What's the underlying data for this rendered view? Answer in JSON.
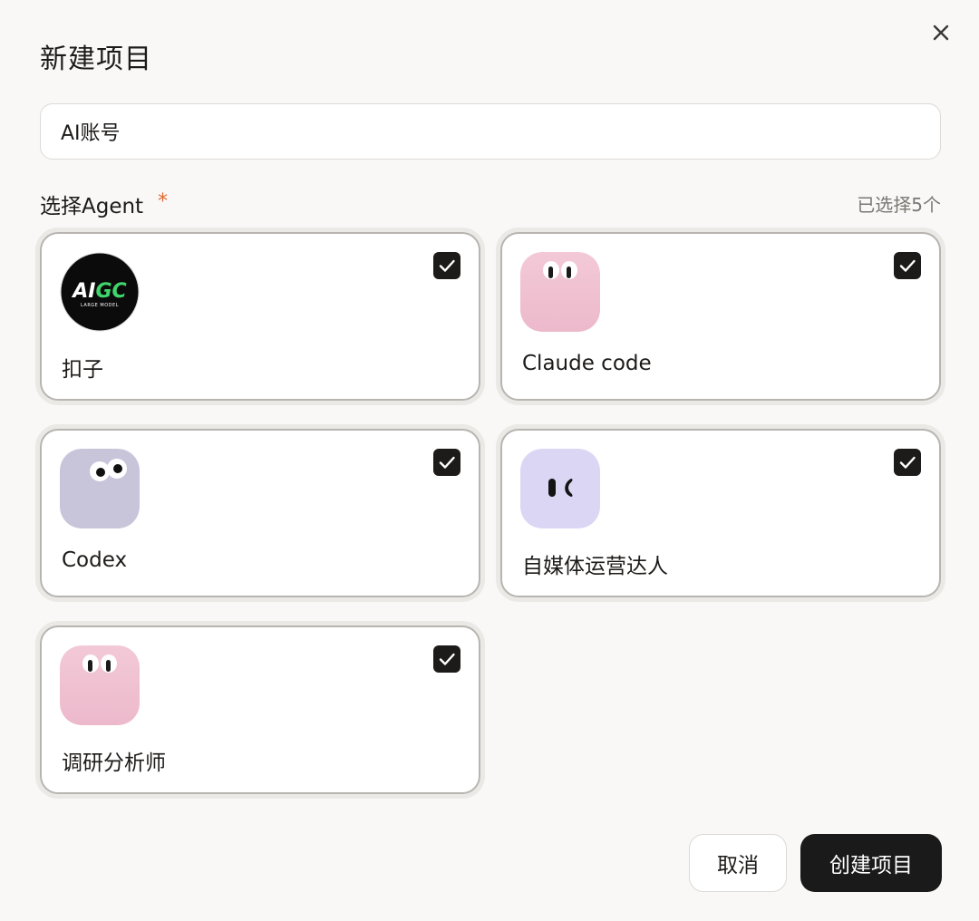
{
  "dialog": {
    "title": "新建项目",
    "close_icon": "close-icon"
  },
  "project_name": {
    "value": "AI账号"
  },
  "agent_section": {
    "label": "选择Agent",
    "required_mark": "*",
    "selected_count": "已选择5个"
  },
  "agents": [
    {
      "label": "扣子",
      "checked": true,
      "avatar": "aigc-logo",
      "logo_text_main": "AIGC",
      "logo_text_sub": "LARGE MODEL"
    },
    {
      "label": "Claude code",
      "checked": true,
      "avatar": "pink-face-icon"
    },
    {
      "label": "Codex",
      "checked": true,
      "avatar": "lavender-face-icon"
    },
    {
      "label": "自媒体运营达人",
      "checked": true,
      "avatar": "purple-face-icon"
    },
    {
      "label": "调研分析师",
      "checked": true,
      "avatar": "pink-face-icon"
    }
  ],
  "footer": {
    "cancel_label": "取消",
    "create_label": "创建项目"
  },
  "colors": {
    "accent_required": "#e2672e",
    "primary_button": "#1a1a1a",
    "pink_avatar": "#efc0d0",
    "lavender_avatar": "#c8c5da",
    "purple_avatar": "#dcd6f5",
    "aigc_green": "#3fd66b"
  }
}
